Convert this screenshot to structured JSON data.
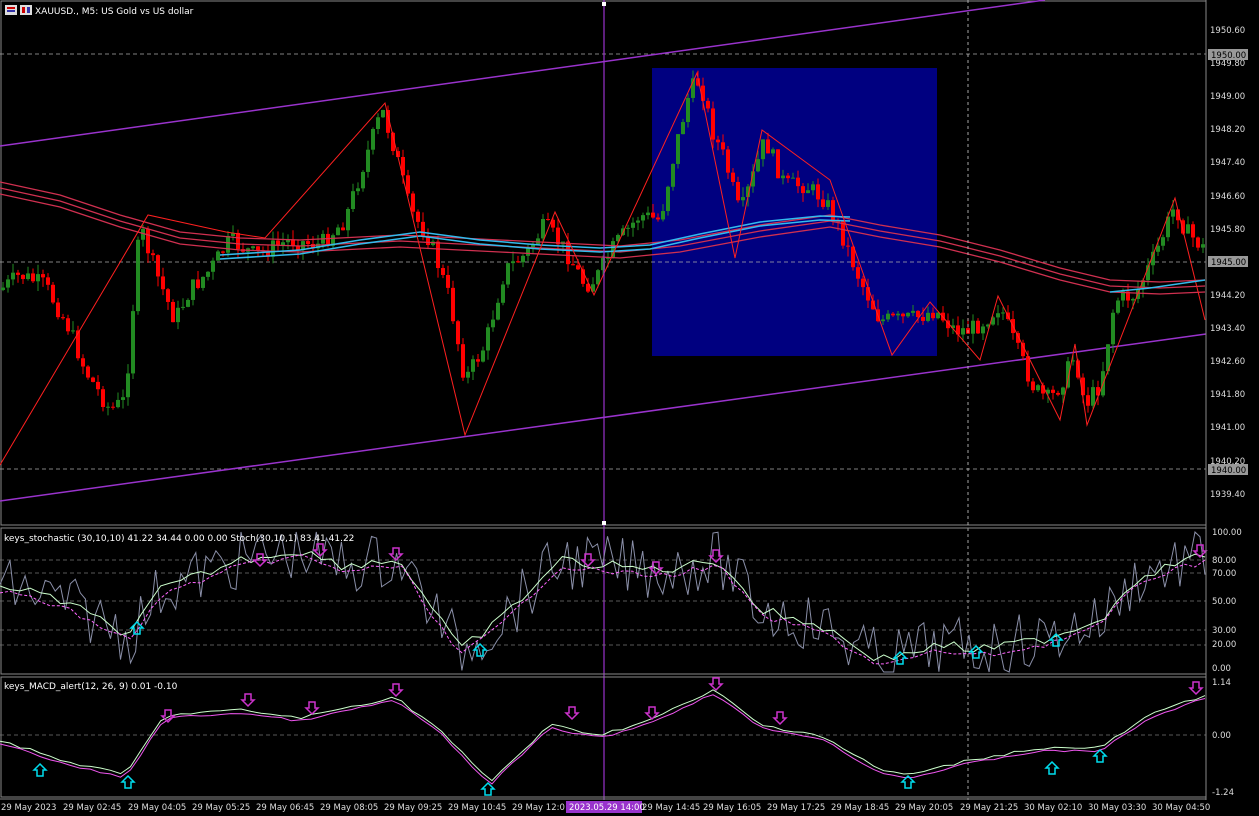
{
  "window": {
    "symbol_title": "XAUUSD., M5:  US Gold vs US dollar",
    "stoch_title": "keys_stochastic (30,10,10) 41.22 34.44 0.00 0.00 Stoch(30,10,1) 83.41 41.22",
    "macd_title": "keys_MACD_alert(12, 26, 9) 0.01 -0.10"
  },
  "price_axis": {
    "ticks": [
      "1950.60",
      "1949.80",
      "1949.00",
      "1948.20",
      "1947.40",
      "1946.60",
      "1945.80",
      "1944.20",
      "1943.40",
      "1942.60",
      "1941.80",
      "1941.00",
      "1940.20",
      "1939.40"
    ],
    "marked_levels": [
      "1950.00",
      "1945.00",
      "1940.00"
    ]
  },
  "stoch_axis": {
    "ticks": [
      "100.00",
      "80.00",
      "70.00",
      "50.00",
      "30.00",
      "20.00",
      "0.00"
    ]
  },
  "macd_axis": {
    "ticks": [
      "1.14",
      "0.00",
      "-1.24"
    ]
  },
  "time_axis": {
    "labels": [
      "29 May 2023",
      "29 May 02:45",
      "29 May 04:05",
      "29 May 05:25",
      "29 May 06:45",
      "29 May 08:05",
      "29 May 09:25",
      "29 May 10:45",
      "29 May 12:0",
      "29 May 14:45",
      "29 May 16:05",
      "29 May 17:25",
      "29 May 18:45",
      "29 May 20:05",
      "29 May 21:25",
      "30 May 02:10",
      "30 May 03:30",
      "30 May 04:50"
    ],
    "crosshair_label": "2023.05.29 14:00"
  },
  "colors": {
    "bull": "#228b22",
    "bear": "#ff0000",
    "channel": "#9933cc",
    "ma_red": "#d03050",
    "ma_blue": "#33bbee",
    "rect": "#000080",
    "zigzag": "#ff2020",
    "arrow_up": "#00ddee",
    "arrow_down": "#cc33cc"
  }
}
